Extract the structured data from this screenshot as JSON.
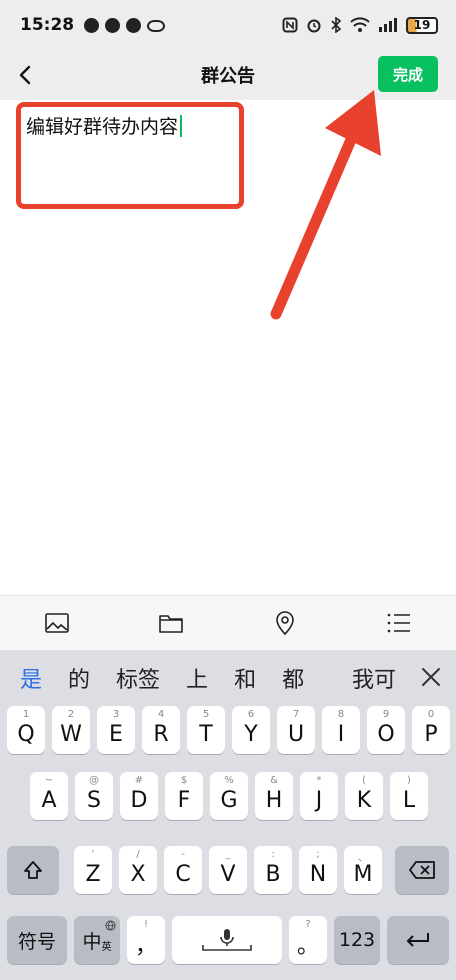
{
  "status": {
    "time": "15:28",
    "battery": "19"
  },
  "nav": {
    "title": "群公告",
    "done_label": "完成"
  },
  "editor": {
    "text": "编辑好群待办内容"
  },
  "toolbar": {
    "icons": [
      "image-icon",
      "folder-icon",
      "location-icon",
      "list-icon"
    ]
  },
  "keyboard": {
    "candidates": [
      "是",
      "的",
      "标签",
      "上",
      "和",
      "都"
    ],
    "candidate_clipped": "我可",
    "row1": [
      {
        "key": "Q",
        "sub": "1"
      },
      {
        "key": "W",
        "sub": "2"
      },
      {
        "key": "E",
        "sub": "3"
      },
      {
        "key": "R",
        "sub": "4"
      },
      {
        "key": "T",
        "sub": "5"
      },
      {
        "key": "Y",
        "sub": "6"
      },
      {
        "key": "U",
        "sub": "7"
      },
      {
        "key": "I",
        "sub": "8"
      },
      {
        "key": "O",
        "sub": "9"
      },
      {
        "key": "P",
        "sub": "0"
      }
    ],
    "row2": [
      {
        "key": "A",
        "sub": "~"
      },
      {
        "key": "S",
        "sub": "@"
      },
      {
        "key": "D",
        "sub": "#"
      },
      {
        "key": "F",
        "sub": "$"
      },
      {
        "key": "G",
        "sub": "%"
      },
      {
        "key": "H",
        "sub": "&"
      },
      {
        "key": "J",
        "sub": "*"
      },
      {
        "key": "K",
        "sub": "("
      },
      {
        "key": "L",
        "sub": ")"
      }
    ],
    "row3": [
      {
        "key": "Z",
        "sub": "'"
      },
      {
        "key": "X",
        "sub": "/"
      },
      {
        "key": "C",
        "sub": "-"
      },
      {
        "key": "V",
        "sub": "_"
      },
      {
        "key": "B",
        "sub": ":"
      },
      {
        "key": "N",
        "sub": ";"
      },
      {
        "key": "M",
        "sub": "、"
      }
    ],
    "symbols_label": "符号",
    "lang_main": "中",
    "lang_sub": "英",
    "comma_label": "，",
    "comma_sub": "!",
    "period_label": "。",
    "period_sub": "?",
    "num_label": "123"
  },
  "colors": {
    "accent": "#07c160",
    "annotation": "#e8412e",
    "candidate_highlight": "#2f6fe0"
  }
}
